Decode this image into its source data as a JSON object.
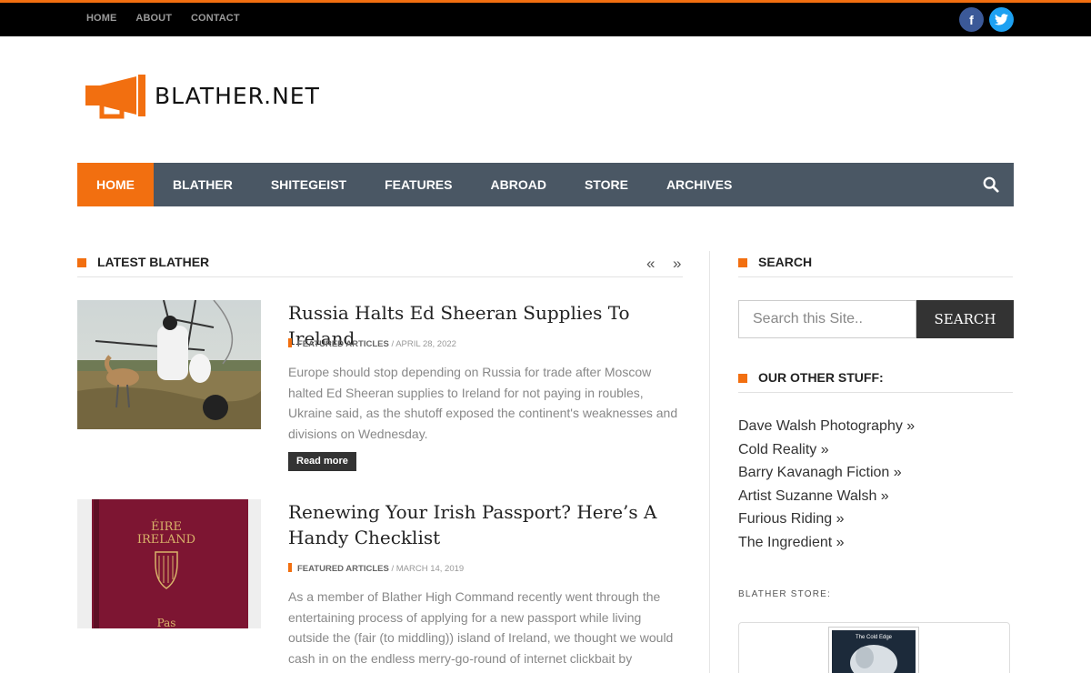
{
  "topnav": [
    "HOME",
    "ABOUT",
    "CONTACT"
  ],
  "social": {
    "facebook": "f",
    "twitter": "twitter-icon"
  },
  "logo": {
    "text": "BLATHER.NET",
    "icon": "megaphone-icon"
  },
  "mainnav": [
    "HOME",
    "BLATHER",
    "SHITEGEIST",
    "FEATURES",
    "ABROAD",
    "STORE",
    "ARCHIVES"
  ],
  "latest": {
    "heading": "LATEST BLATHER",
    "prev": "«",
    "next": "»"
  },
  "articles": [
    {
      "title": "Russia Halts Ed Sheeran Supplies To Ireland",
      "category": "FEATURED ARTICLES",
      "separator": " / ",
      "date": "APRIL 28, 2022",
      "excerpt": "Europe should stop depending on Russia for trade after Moscow halted Ed Sheeran supplies to Ireland for not paying in roubles, Ukraine said, as the shutoff exposed the continent's weaknesses and divisions on Wednesday.",
      "read_more": "Read more"
    },
    {
      "title": "Renewing Your Irish Passport? Here’s A Handy Checklist",
      "category": "FEATURED ARTICLES",
      "separator": " / ",
      "date": "MARCH 14, 2019",
      "excerpt": "As a member of Blather High Command recently went through the entertaining process of applying for a new passport while living outside the (fair (to middling)) island of Ireland, we thought we would cash in on the endless merry-go-round of internet clickbait by",
      "passport_text": [
        "ÉIRE",
        "IRELAND",
        "Pas"
      ]
    }
  ],
  "sidebar": {
    "search_heading": "SEARCH",
    "search_placeholder": "Search this Site..",
    "search_button": "SEARCH",
    "other_heading": "OUR OTHER STUFF:",
    "other_links": [
      "Dave Walsh Photography »",
      "Cold Reality »",
      "Barry Kavanagh Fiction »",
      "Artist Suzanne Walsh »",
      "Furious Riding »",
      "The Ingredient »"
    ],
    "store_label": "BLATHER STORE:",
    "store_item_text": "The Cold Edge"
  },
  "colors": {
    "accent": "#f26f10",
    "nav": "#4a5764",
    "topbar": "#000000"
  }
}
